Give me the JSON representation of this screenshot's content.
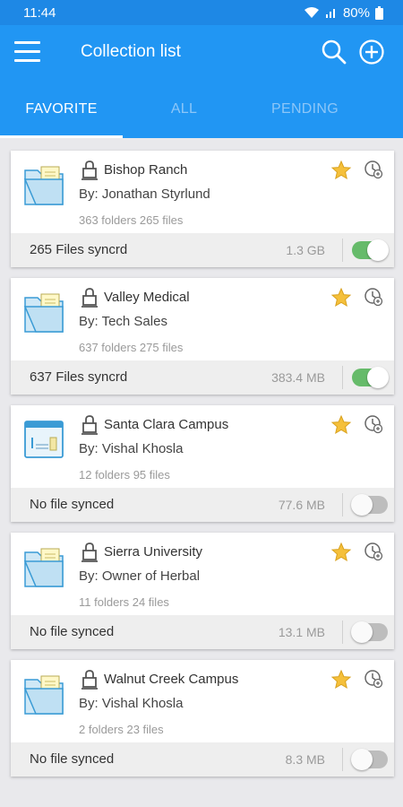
{
  "status_bar": {
    "time": "11:44",
    "battery": "80%",
    "icons": [
      "wifi-icon",
      "signal-icon",
      "battery-icon"
    ]
  },
  "app_bar": {
    "title": "Collection list",
    "icons": [
      "hamburger-menu-icon",
      "search-icon",
      "add-circle-icon"
    ]
  },
  "tabs": [
    {
      "label": "FAVORITE",
      "active": true
    },
    {
      "label": "ALL",
      "active": false
    },
    {
      "label": "PENDING",
      "active": false
    }
  ],
  "colors": {
    "primary": "#2196f3",
    "status_bar": "#1e88e5",
    "toggle_on": "#66bb6a",
    "toggle_off": "#bdbdbd",
    "star": "#f5c03b"
  },
  "collections": [
    {
      "name": "Bishop Ranch",
      "by": "By:  Jonathan Styrlund",
      "counts": "363 folders 265 files",
      "sync_status": "265 Files syncrd",
      "size": "1.3 GB",
      "synced": true,
      "favorite": true,
      "thumbnail": "folder-icon"
    },
    {
      "name": "Valley Medical",
      "by": "By: Tech Sales",
      "counts": "637 folders 275 files",
      "sync_status": "637 Files syncrd",
      "size": "383.4 MB",
      "synced": true,
      "favorite": true,
      "thumbnail": "folder-icon"
    },
    {
      "name": "Santa Clara Campus",
      "by": "By: Vishal Khosla",
      "counts": "12 folders 95 files",
      "sync_status": "No file synced",
      "size": "77.6 MB",
      "synced": false,
      "favorite": true,
      "thumbnail": "chart-window-icon"
    },
    {
      "name": "Sierra University",
      "by": "By: Owner of Herbal",
      "counts": "11 folders 24 files",
      "sync_status": "No file synced",
      "size": "13.1 MB",
      "synced": false,
      "favorite": true,
      "thumbnail": "folder-icon"
    },
    {
      "name": "Walnut Creek Campus",
      "by": "By: Vishal Khosla",
      "counts": "2 folders 23 files",
      "sync_status": "No file synced",
      "size": "8.3 MB",
      "synced": false,
      "favorite": true,
      "thumbnail": "folder-icon"
    }
  ]
}
